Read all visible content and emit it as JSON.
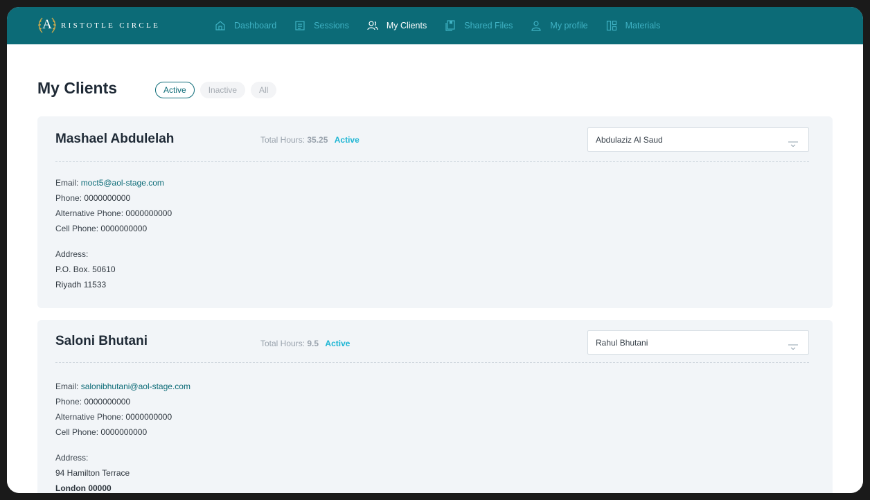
{
  "brand": {
    "letter": "A",
    "name": "RISTOTLE  CIRCLE"
  },
  "nav": [
    {
      "label": "Dashboard",
      "icon": "home-icon"
    },
    {
      "label": "Sessions",
      "icon": "document-icon"
    },
    {
      "label": "My Clients",
      "icon": "users-icon",
      "active": true
    },
    {
      "label": "Shared Files",
      "icon": "files-icon"
    },
    {
      "label": "My profile",
      "icon": "user-icon"
    },
    {
      "label": "Materials",
      "icon": "grid-icon"
    }
  ],
  "page": {
    "title": "My Clients",
    "tabs": [
      "Active",
      "Inactive",
      "All"
    ],
    "selected_tab": "Active"
  },
  "clients": [
    {
      "name": "Mashael Abdulelah",
      "hours_label": "Total Hours:",
      "hours": "35.25",
      "status": "Active",
      "assigned": "Abdulaziz Al Saud",
      "email_label": "Email:",
      "email": "moct5@aol-stage.com",
      "phone_label": "Phone:",
      "phone": "0000000000",
      "alt_phone_label": "Alternative Phone:",
      "alt_phone": "0000000000",
      "cell_phone_label": "Cell Phone:",
      "cell_phone": "0000000000",
      "address_label": "Address:",
      "address": [
        "P.O. Box. 50610",
        "Riyadh 11533"
      ]
    },
    {
      "name": "Saloni Bhutani",
      "hours_label": "Total Hours:",
      "hours": "9.5",
      "status": "Active",
      "assigned": "Rahul Bhutani",
      "email_label": "Email:",
      "email": "salonibhutani@aol-stage.com",
      "phone_label": "Phone:",
      "phone": "0000000000",
      "alt_phone_label": "Alternative Phone:",
      "alt_phone": "0000000000",
      "cell_phone_label": "Cell Phone:",
      "cell_phone": "0000000000",
      "address_label": "Address:",
      "address": [
        "94 Hamilton Terrace",
        "London 00000"
      ]
    }
  ],
  "colors": {
    "nav_bg": "#0c6b77",
    "nav_link": "#3fb2c4",
    "status_active": "#1fb6d4",
    "card_bg": "#f2f5f8"
  }
}
